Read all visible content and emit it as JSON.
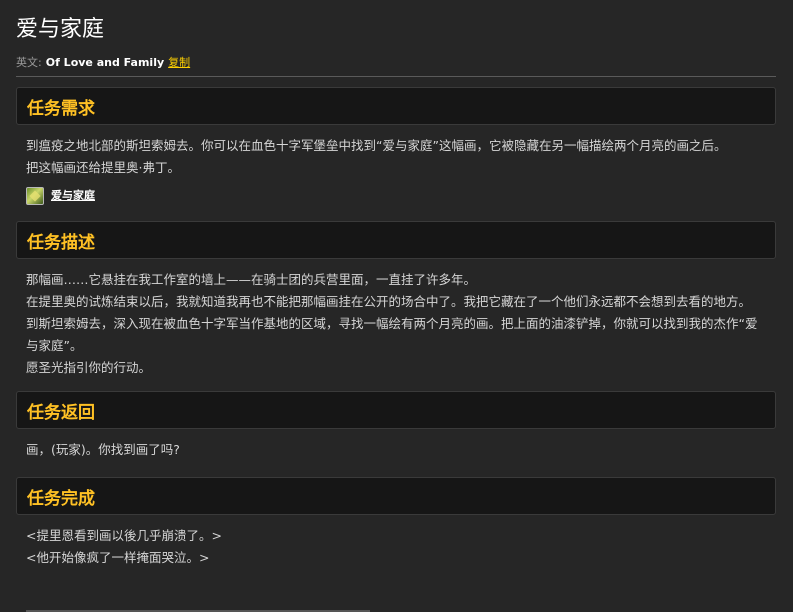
{
  "page": {
    "title": "爱与家庭",
    "english_label": "英文:",
    "english_name": "Of Love and Family",
    "copy_label": "复制"
  },
  "sections": [
    {
      "header": "任务需求",
      "lines": [
        "到瘟疫之地北部的斯坦索姆去。你可以在血色十字军堡垒中找到“爱与家庭”这幅画，它被隐藏在另一幅描绘两个月亮的画之后。",
        "把这幅画还给提里奥·弗丁。"
      ],
      "item": {
        "icon": "painting-item-icon",
        "label": "爱与家庭"
      }
    },
    {
      "header": "任务描述",
      "lines": [
        "那幅画……它悬挂在我工作室的墙上——在骑士团的兵营里面，一直挂了许多年。",
        "在提里奥的试炼结束以后，我就知道我再也不能把那幅画挂在公开的场合中了。我把它藏在了一个他们永远都不会想到去看的地方。",
        "到斯坦索姆去，深入现在被血色十字军当作基地的区域，寻找一幅绘有两个月亮的画。把上面的油漆铲掉，你就可以找到我的杰作“爱与家庭”。",
        "愿圣光指引你的行动。"
      ]
    },
    {
      "header": "任务返回",
      "lines": [
        "画，(玩家)。你找到画了吗?"
      ]
    },
    {
      "header": "任务完成",
      "lines": [
        "<提里恩看到画以後几乎崩溃了。>",
        "<他开始像疯了一样掩面哭泣。>"
      ]
    }
  ],
  "colors": {
    "background": "#262626",
    "header_bg": "#161616",
    "accent": "#ffc124",
    "link": "#ffd100"
  }
}
